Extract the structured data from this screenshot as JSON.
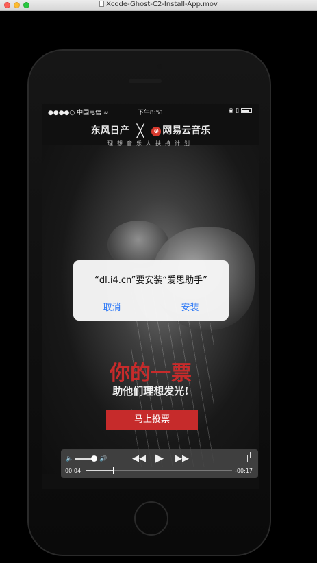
{
  "window": {
    "title": "Xcode-Ghost-C2-Install-App.mov"
  },
  "phone_status": {
    "carrier": "●●●●○ 中国电信 ≈",
    "time": "下午8:51",
    "right": "◉ ▯"
  },
  "ad": {
    "brand_left": "东风日产",
    "brand_x": "╳",
    "brand_right": "网易云音乐",
    "netease_glyph": "⊙",
    "tagline": "理想音乐人扶持计划",
    "headline": "你的一票",
    "subline": "助他们理想发光!",
    "vote_button": "马上投票"
  },
  "alert": {
    "title": "“dl.i4.cn”要安装“爱思助手”",
    "cancel": "取消",
    "install": "安装"
  },
  "player": {
    "elapsed": "00:04",
    "remaining": "-00:17",
    "progress": 0.19,
    "volume": 0.8,
    "icons": {
      "vol_low": "🔈",
      "vol_high": "🔊",
      "rewind": "◀◀",
      "play": "▶",
      "forward": "▶▶"
    }
  }
}
